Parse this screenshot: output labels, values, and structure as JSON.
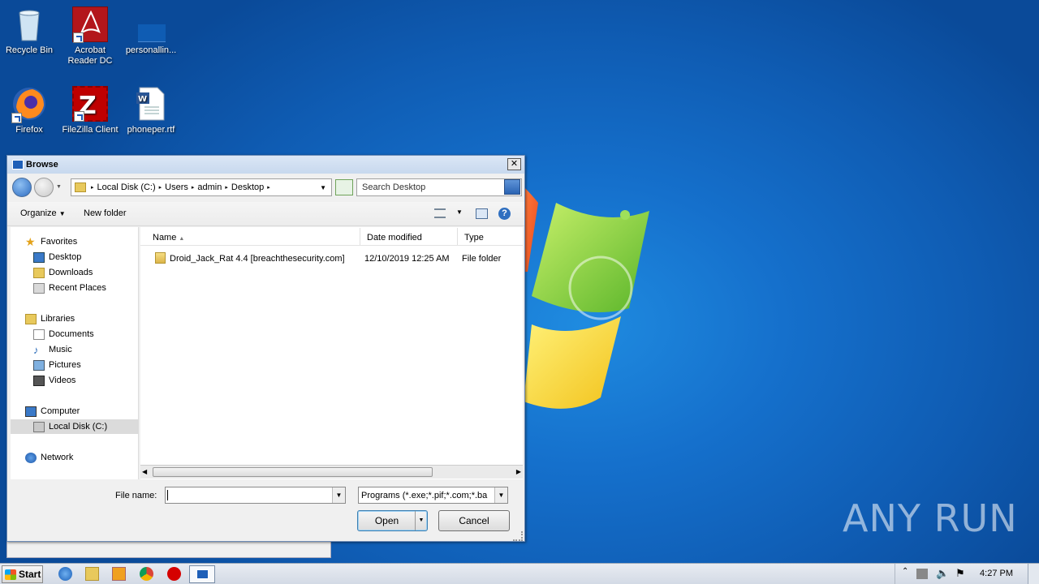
{
  "desktop": {
    "icons": [
      {
        "label": "Recycle Bin",
        "icon": "recycle-bin-icon"
      },
      {
        "label": "Acrobat Reader DC",
        "icon": "acrobat-icon"
      },
      {
        "label": "personallin...",
        "icon": "blank-file-icon"
      },
      {
        "label": "Firefox",
        "icon": "firefox-icon"
      },
      {
        "label": "FileZilla Client",
        "icon": "filezilla-icon"
      },
      {
        "label": "phoneper.rtf",
        "icon": "word-doc-icon"
      }
    ],
    "watermark": "ANY RUN"
  },
  "dialog": {
    "title": "Browse",
    "close": "✕",
    "breadcrumb": [
      "Local Disk (C:)",
      "Users",
      "admin",
      "Desktop"
    ],
    "search_placeholder": "Search Desktop",
    "toolbar": {
      "organize": "Organize",
      "new_folder": "New folder"
    },
    "nav": {
      "favorites": "Favorites",
      "desktop": "Desktop",
      "downloads": "Downloads",
      "recent": "Recent Places",
      "libraries": "Libraries",
      "documents": "Documents",
      "music": "Music",
      "pictures": "Pictures",
      "videos": "Videos",
      "computer": "Computer",
      "local_disk": "Local Disk (C:)",
      "network": "Network"
    },
    "columns": {
      "name": "Name",
      "date": "Date modified",
      "type": "Type"
    },
    "files": [
      {
        "name": "Droid_Jack_Rat 4.4 [breachthesecurity.com]",
        "date": "12/10/2019 12:25 AM",
        "type": "File folder"
      }
    ],
    "file_name_label": "File name:",
    "file_name_value": "",
    "file_type": "Programs (*.exe;*.pif;*.com;*.ba",
    "open": "Open",
    "cancel": "Cancel"
  },
  "taskbar": {
    "start": "Start",
    "time": "4:27 PM"
  }
}
